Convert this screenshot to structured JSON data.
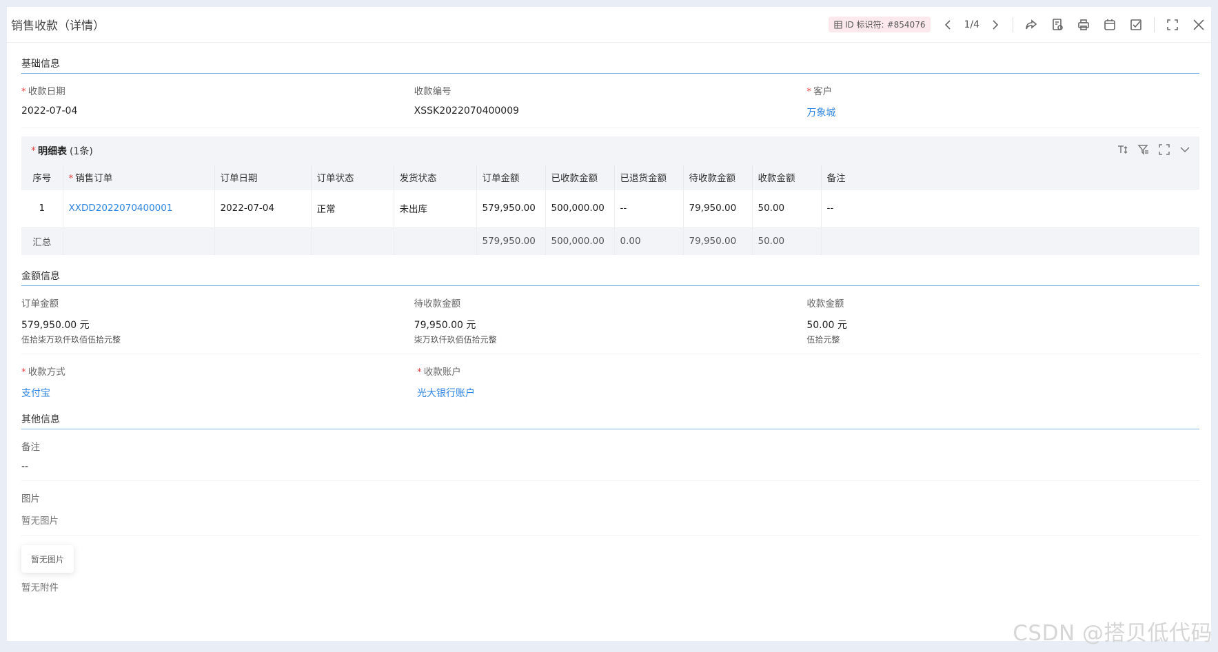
{
  "header": {
    "title": "销售收款（详情）",
    "id_label": "ID 标识符:",
    "id_value": "#854076",
    "pager": "1/4"
  },
  "basic": {
    "section_title": "基础信息",
    "fields": [
      {
        "label": "收款日期",
        "value": "2022-07-04"
      },
      {
        "label": "收款编号",
        "value": "XSSK2022070400009"
      },
      {
        "label": "客户",
        "value": "万象城"
      }
    ]
  },
  "detail": {
    "title": "明细表",
    "count": "(1条)",
    "columns": [
      "序号",
      "销售订单",
      "订单日期",
      "订单状态",
      "发货状态",
      "订单金额",
      "已收款金额",
      "已退货金额",
      "待收款金额",
      "收款金额",
      "备注"
    ],
    "rows": [
      [
        "1",
        "XXDD2022070400001",
        "2022-07-04",
        "正常",
        "未出库",
        "579,950.00",
        "500,000.00",
        "--",
        "79,950.00",
        "50.00",
        "--"
      ]
    ],
    "summary": [
      "汇总",
      "",
      "",
      "",
      "",
      "579,950.00",
      "500,000.00",
      "0.00",
      "79,950.00",
      "50.00",
      ""
    ]
  },
  "amount": {
    "section_title": "金额信息",
    "fields": [
      {
        "label": "订单金额",
        "value": "579,950.00 元",
        "sub": "伍拾柒万玖仟玖佰伍拾元整"
      },
      {
        "label": "待收款金额",
        "value": "79,950.00 元",
        "sub": "柒万玖仟玖佰伍拾元整"
      },
      {
        "label": "收款金额",
        "value": "50.00 元",
        "sub": "伍拾元整"
      }
    ],
    "method_label": "收款方式",
    "method_value": "支付宝",
    "account_label": "收款账户",
    "account_value": "光大银行账户"
  },
  "other": {
    "section_title": "其他信息",
    "remark_label": "备注",
    "remark_value": "--",
    "image_label": "图片",
    "image_empty": "暂无图片",
    "thumb_text": "暂无图片",
    "attachment_empty": "暂无附件"
  },
  "watermark": "CSDN @搭贝低代码",
  "colors": {
    "link": "#2f86e0",
    "required": "#e64646",
    "section_line": "#7fb4e8"
  }
}
